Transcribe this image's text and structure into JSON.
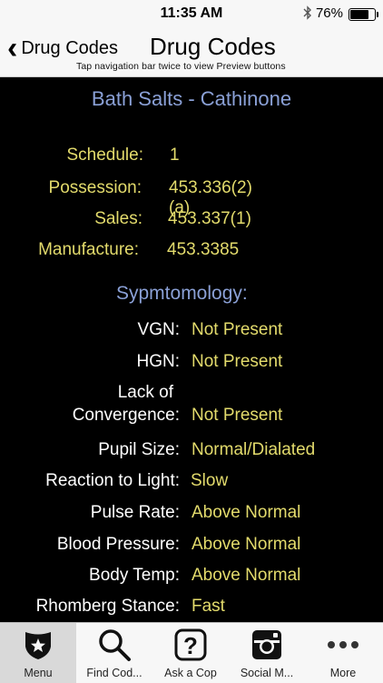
{
  "status": {
    "time": "11:35 AM",
    "bluetooth_icon": "bluetooth-icon",
    "battery_pct": "76%",
    "battery_level": 0.76
  },
  "nav": {
    "back_label": "Drug Codes",
    "title": "Drug Codes",
    "hint": "Tap navigation bar twice to view Preview buttons"
  },
  "drug": {
    "title": "Bath Salts - Cathinone",
    "codes": [
      {
        "label": "Schedule:",
        "value": "1"
      },
      {
        "label": "Possession:",
        "value": "453.336(2)(a)"
      },
      {
        "label": "Sales:",
        "value": "453.337(1)"
      },
      {
        "label": "Manufacture:",
        "value": "453.3385"
      }
    ]
  },
  "symptoms": {
    "heading": "Sypmtomology:",
    "items": [
      {
        "label": "VGN:",
        "value": "Not Present"
      },
      {
        "label": "HGN:",
        "value": "Not Present"
      },
      {
        "label_line1": "Lack of",
        "label_line2": "Convergence:",
        "value": "Not Present"
      },
      {
        "label": "Pupil Size:",
        "value": "Normal/Dialated"
      },
      {
        "label": "Reaction to Light:",
        "value": "Slow"
      },
      {
        "label": "Pulse Rate:",
        "value": "Above Normal"
      },
      {
        "label": "Blood Pressure:",
        "value": "Above Normal"
      },
      {
        "label": "Body Temp:",
        "value": "Above Normal"
      },
      {
        "label": "Rhomberg Stance:",
        "value": "Fast"
      }
    ]
  },
  "tabs": [
    {
      "label": "Menu",
      "icon": "badge-star-icon",
      "active": true
    },
    {
      "label": "Find Cod...",
      "icon": "search-icon"
    },
    {
      "label": "Ask a Cop",
      "icon": "question-icon"
    },
    {
      "label": "Social M...",
      "icon": "instagram-icon"
    },
    {
      "label": "More",
      "icon": "more-dots-icon"
    }
  ],
  "colors": {
    "background": "#000000",
    "value_yellow": "#e3db6c",
    "heading_blue": "#8aa0d6",
    "bar_gray": "#f7f7f7"
  }
}
